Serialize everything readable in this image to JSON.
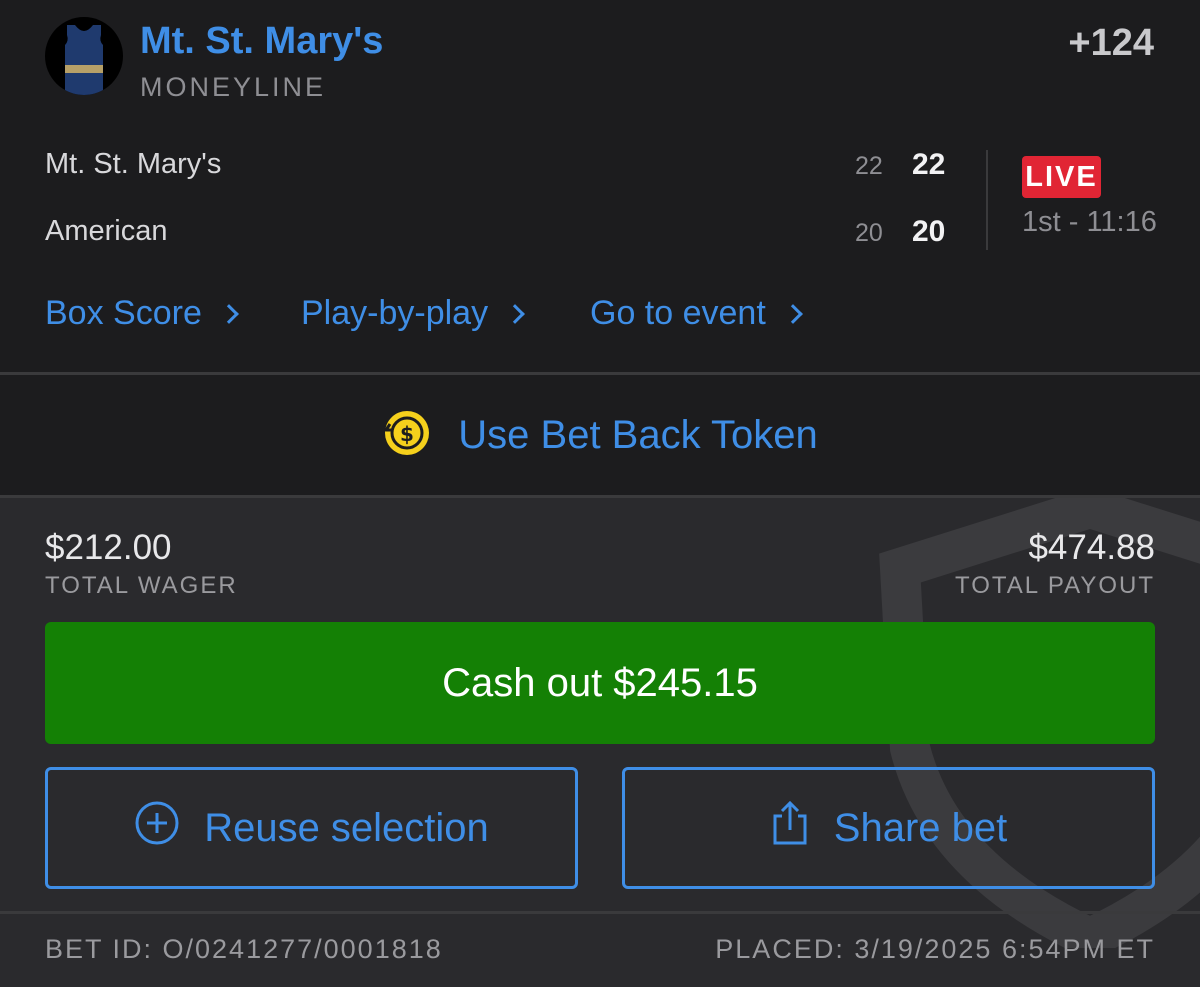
{
  "selection": {
    "team": "Mt. St. Mary's",
    "market": "MONEYLINE",
    "odds": "+124",
    "jersey_icon": "jersey-icon",
    "jersey_color": "#1f3a6e",
    "jersey_stripe": "#b6a068"
  },
  "scoreboard": {
    "teams": [
      {
        "name": "Mt. St. Mary's",
        "period_score": "22",
        "total_score": "22"
      },
      {
        "name": "American",
        "period_score": "20",
        "total_score": "20"
      }
    ],
    "status_badge": "LIVE",
    "clock": "1st - 11:16"
  },
  "links": [
    {
      "label": "Box Score",
      "icon": "chevron-right-icon"
    },
    {
      "label": "Play-by-play",
      "icon": "chevron-right-icon"
    },
    {
      "label": "Go to event",
      "icon": "chevron-right-icon"
    }
  ],
  "bet_back": {
    "label": "Use Bet Back Token",
    "icon": "dollar-token-icon"
  },
  "wager": {
    "total_wager": "$212.00",
    "total_wager_label": "TOTAL WAGER",
    "total_payout": "$474.88",
    "total_payout_label": "TOTAL PAYOUT"
  },
  "actions": {
    "cashout_label": "Cash out $245.15",
    "reuse_label": "Reuse selection",
    "reuse_icon": "plus-circle-icon",
    "share_label": "Share bet",
    "share_icon": "share-icon"
  },
  "footer": {
    "bet_id": "BET ID: O/0241277/0001818",
    "placed": "PLACED: 3/19/2025 6:54PM ET"
  },
  "colors": {
    "accent_blue": "#3f8ee6",
    "live_red": "#e12534",
    "cashout_green": "#148005",
    "token_yellow": "#f5d01c"
  }
}
